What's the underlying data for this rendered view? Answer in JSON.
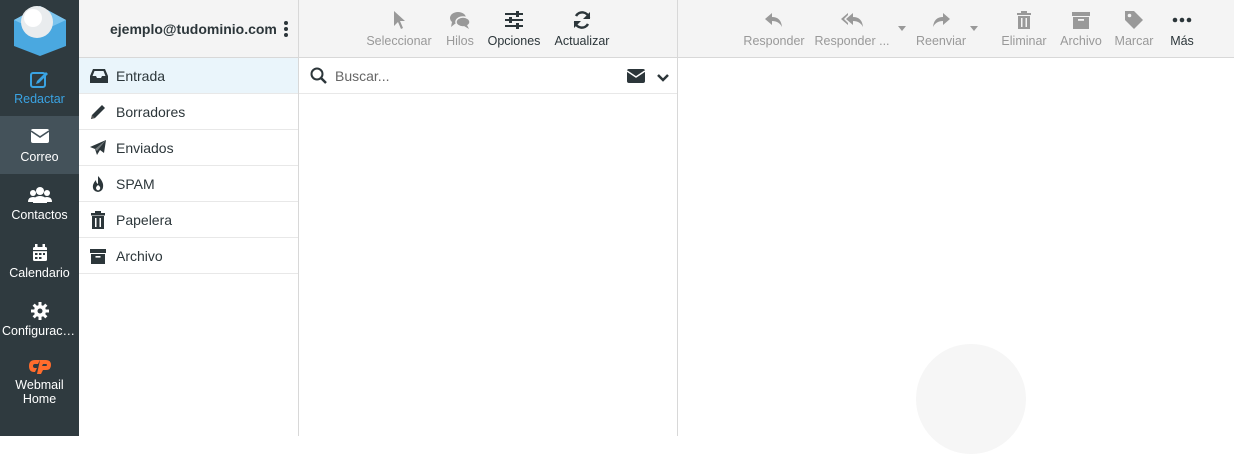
{
  "nav": {
    "items": [
      {
        "key": "compose",
        "label": "Redactar",
        "icon": "compose-icon"
      },
      {
        "key": "mail",
        "label": "Correo",
        "icon": "envelope-icon"
      },
      {
        "key": "contacts",
        "label": "Contactos",
        "icon": "users-icon"
      },
      {
        "key": "calendar",
        "label": "Calendario",
        "icon": "calendar-icon"
      },
      {
        "key": "settings",
        "label": "Configuración",
        "icon": "gear-icon"
      },
      {
        "key": "home",
        "label": "Webmail Home",
        "icon": "cpanel-icon"
      }
    ]
  },
  "account": {
    "email": "ejemplo@tudominio.com"
  },
  "folders": [
    {
      "label": "Entrada",
      "icon": "inbox-icon"
    },
    {
      "label": "Borradores",
      "icon": "pencil-icon"
    },
    {
      "label": "Enviados",
      "icon": "paper-plane-icon"
    },
    {
      "label": "SPAM",
      "icon": "fire-icon"
    },
    {
      "label": "Papelera",
      "icon": "trash-icon"
    },
    {
      "label": "Archivo",
      "icon": "archive-icon"
    }
  ],
  "list_toolbar": {
    "select": "Seleccionar",
    "threads": "Hilos",
    "options": "Opciones",
    "refresh": "Actualizar"
  },
  "search": {
    "placeholder": "Buscar..."
  },
  "message_toolbar": {
    "reply": "Responder",
    "reply_all": "Responder ...",
    "forward": "Reenviar",
    "delete": "Eliminar",
    "archive": "Archivo",
    "mark": "Marcar",
    "more": "Más"
  },
  "colors": {
    "accent": "#3aa3e3",
    "nav_bg": "#2f3a3f",
    "nav_active": "#44525a",
    "selected_folder": "#eaf5fb",
    "cpanel_orange": "#ff6c2c"
  }
}
